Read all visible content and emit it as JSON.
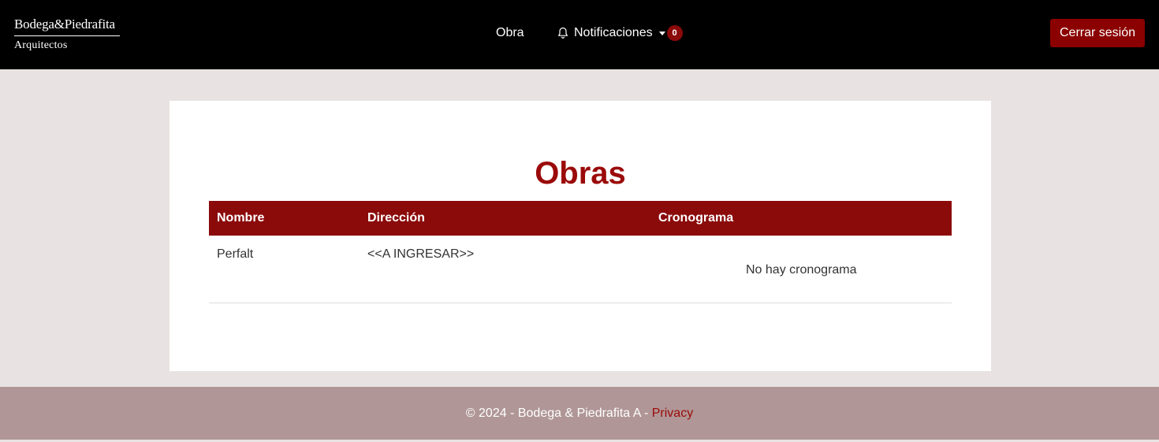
{
  "brand": {
    "line1": "Bodega&Piedrafita",
    "line2": "Arquitectos"
  },
  "nav": {
    "obra": "Obra",
    "notifications_label": "Notificaciones",
    "notifications_count": "0",
    "logout": "Cerrar sesión"
  },
  "page": {
    "title": "Obras"
  },
  "table": {
    "headers": [
      "Nombre",
      "Dirección",
      "Cronograma"
    ],
    "rows": [
      {
        "nombre": "Perfalt",
        "direccion": "<<A INGRESAR>>",
        "cronograma": "No hay cronograma"
      }
    ]
  },
  "footer": {
    "text": "© 2024 - Bodega & Piedrafita A - ",
    "link": "Privacy"
  },
  "colors": {
    "navbar": "#000000",
    "accent": "#8b0a0a",
    "page_bg": "#e8e3e2",
    "footer_bg": "#b09696"
  }
}
